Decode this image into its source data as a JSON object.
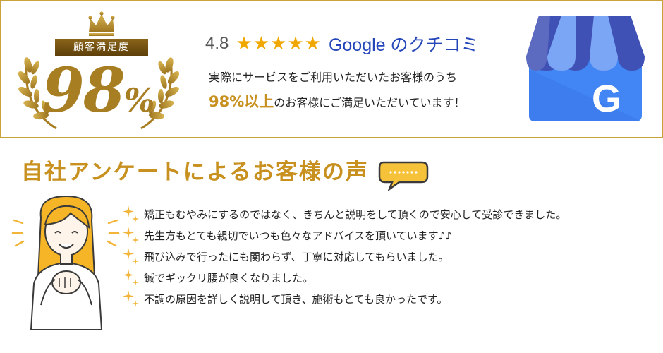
{
  "badge": {
    "label": "顧客満足度",
    "value": "98",
    "unit": "%"
  },
  "rating": {
    "score": "4.8",
    "stars": 5,
    "source": "Google のクチコミ"
  },
  "summary": {
    "line1": "実際にサービスをご利用いただいたお客様のうち",
    "highlight": "98%以上",
    "line2_rest": "のお客様にご満足いただいています！"
  },
  "store_icon": {
    "letter": "G",
    "colors": {
      "dark_blue": "#3f51b5",
      "light_blue": "#4285f4",
      "shadow": "#2a56c6"
    }
  },
  "section": {
    "title": "自社アンケートによるお客様の声"
  },
  "reviews": [
    {
      "text": "矯正もむやみにするのではなく、きちんと説明をして頂くので安心して受診できました。"
    },
    {
      "text": "先生方もとても親切でいつも色々なアドバイスを頂いています♪♪"
    },
    {
      "text": "飛び込みで行ったにも関わらず、丁寧に対応してもらいました。"
    },
    {
      "text": "鍼でギックリ腰が良くなりました。"
    },
    {
      "text": "不調の原因を詳しく説明して頂き、施術もとても良かったです。"
    }
  ],
  "colors": {
    "gold": "#c8901e",
    "border": "#c8a23a",
    "star": "#f0a800",
    "google_blue": "#2546b9"
  }
}
